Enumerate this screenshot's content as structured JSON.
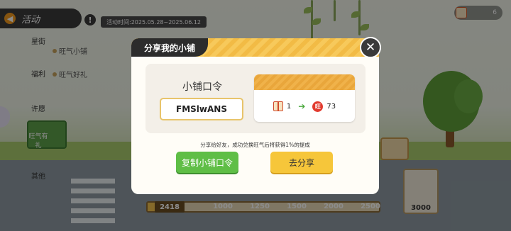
{
  "header": {
    "activity_label": "活动",
    "back_icon": "back-arrow-icon",
    "info_icon": "exclamation-icon",
    "info_glyph": "!",
    "period": "活动时间:2025.05.28~2025.06.12",
    "counter_value": "6",
    "counter_icon": "gift-box-icon"
  },
  "sidebar": {
    "items": [
      {
        "label": "星街"
      },
      {
        "label": "福利"
      },
      {
        "label": "许愿"
      },
      {
        "label": "旺气有礼"
      },
      {
        "label": "其他"
      }
    ],
    "sub_items": [
      {
        "label": "旺气小铺"
      },
      {
        "label": "旺气好礼"
      }
    ]
  },
  "progress": {
    "start_value": "2418",
    "ticks": [
      "1000",
      "1250",
      "1500",
      "2000",
      "2500"
    ],
    "fill_fraction": 0.03,
    "reward_value": "3000"
  },
  "modal": {
    "title": "分享我的小铺",
    "close_glyph": "✕",
    "code_heading": "小铺口令",
    "code_value": "FMSlwANS",
    "exchange": {
      "from_icon": "gift-box-icon",
      "from_count": "1",
      "arrow_glyph": "➔",
      "to_icon": "wang-coin-icon",
      "to_coin_glyph": "旺",
      "to_count": "73"
    },
    "tip": "分享给好友，成功兑换旺气后将获得1%的提成",
    "copy_button": "复制小铺口令",
    "share_button": "去分享"
  },
  "colors": {
    "accent_yellow": "#f6c63a",
    "accent_green": "#5fbe46",
    "title_bg": "#2c2c2c",
    "coin_red": "#e23b2f"
  }
}
